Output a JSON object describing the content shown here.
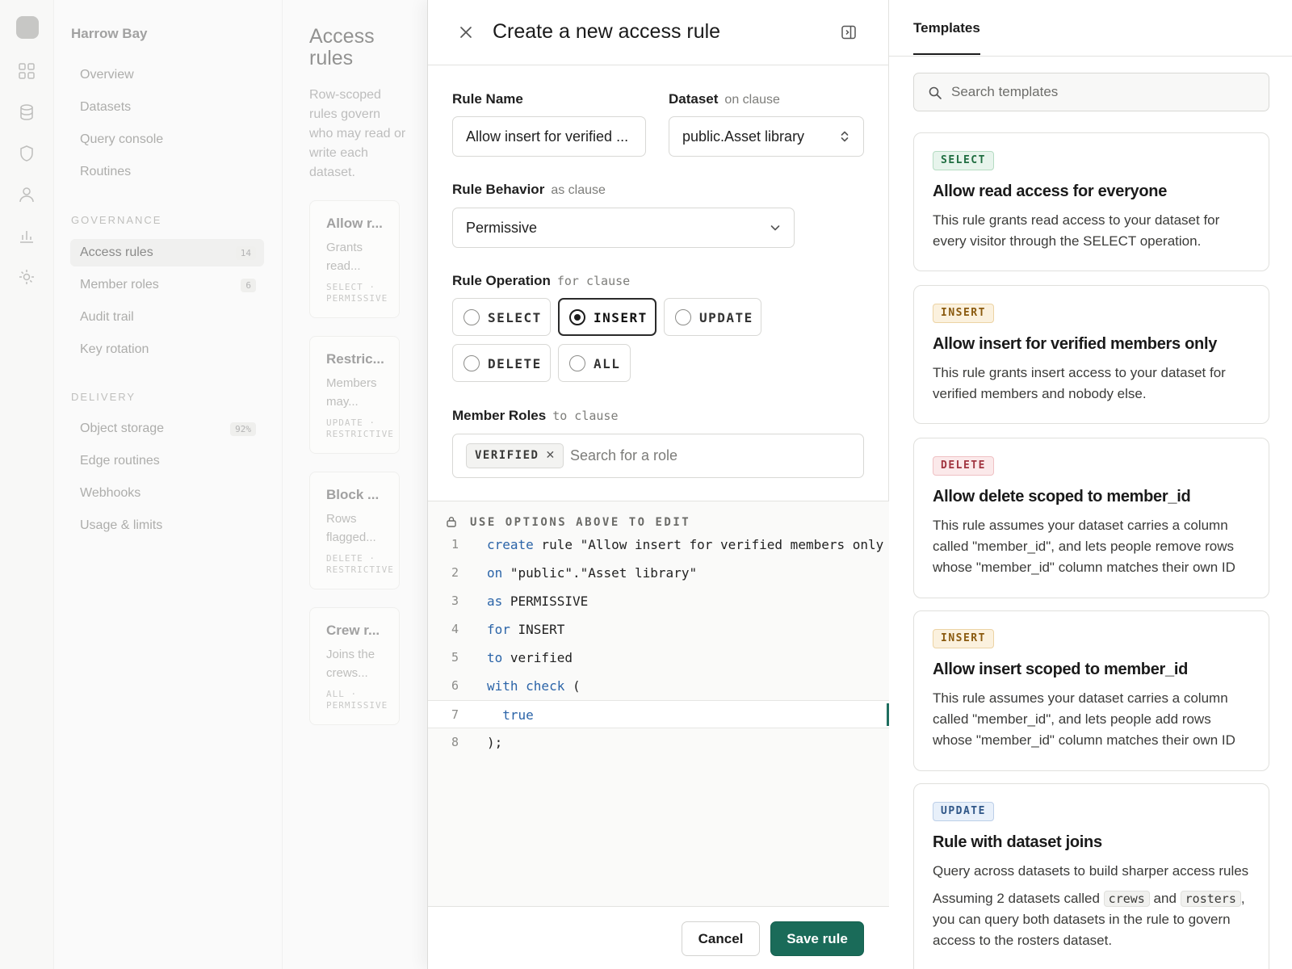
{
  "background": {
    "org_name": "Harrow Bay",
    "nav_items": [
      {
        "label": "Overview"
      },
      {
        "label": "Datasets"
      },
      {
        "label": "Query console"
      },
      {
        "label": "Routines"
      }
    ],
    "governance_section": "GOVERNANCE",
    "governance_items": [
      {
        "label": "Access rules",
        "count": "14"
      },
      {
        "label": "Member roles",
        "count": "6"
      },
      {
        "label": "Audit trail"
      },
      {
        "label": "Key rotation"
      }
    ],
    "delivery_section": "DELIVERY",
    "delivery_items": [
      {
        "label": "Object storage",
        "count": "92%"
      },
      {
        "label": "Edge routines"
      },
      {
        "label": "Webhooks"
      },
      {
        "label": "Usage & limits"
      }
    ],
    "list_title": "Access rules",
    "list_description": "Row-scoped rules govern who may read or write each dataset.",
    "list_cards": [
      {
        "title": "Allow r...",
        "desc": "Grants read...",
        "meta": "SELECT · PERMISSIVE"
      },
      {
        "title": "Restric...",
        "desc": "Members may...",
        "meta": "UPDATE · RESTRICTIVE"
      },
      {
        "title": "Block ...",
        "desc": "Rows flagged...",
        "meta": "DELETE · RESTRICTIVE"
      },
      {
        "title": "Crew r...",
        "desc": "Joins the crews...",
        "meta": "ALL · PERMISSIVE"
      }
    ]
  },
  "modal": {
    "title": "Create a new access rule",
    "rule_name": {
      "label": "Rule Name",
      "value": "Allow insert for verified ..."
    },
    "dataset": {
      "label": "Dataset",
      "hint": "on clause",
      "value": "public.Asset library"
    },
    "behavior": {
      "label": "Rule Behavior",
      "hint": "as clause",
      "value": "Permissive"
    },
    "operation": {
      "label": "Rule Operation",
      "hint": "for clause",
      "options": [
        "SELECT",
        "INSERT",
        "UPDATE",
        "DELETE",
        "ALL"
      ],
      "selected": "INSERT"
    },
    "roles": {
      "label": "Member Roles",
      "hint": "to clause",
      "chip": "VERIFIED",
      "placeholder": "Search for a role"
    },
    "editor": {
      "lock_message": "USE OPTIONS ABOVE TO EDIT",
      "lines": [
        {
          "n": "1",
          "kw": "create",
          "text": " rule \"Allow insert for verified members only"
        },
        {
          "n": "2",
          "kw": "on",
          "text": " \"public\".\"Asset library\""
        },
        {
          "n": "3",
          "kw": "as",
          "text": " PERMISSIVE"
        },
        {
          "n": "4",
          "kw": "for",
          "text": " INSERT"
        },
        {
          "n": "5",
          "kw": "to",
          "text": " verified"
        },
        {
          "n": "6",
          "kw": "with check",
          "text": " ("
        },
        {
          "n": "7",
          "kw": "  true",
          "text": ""
        },
        {
          "n": "8",
          "kw": "",
          "text": ");"
        }
      ]
    },
    "cancel_label": "Cancel",
    "save_label": "Save rule"
  },
  "templates": {
    "tab_label": "Templates",
    "search_placeholder": "Search templates",
    "cards": [
      {
        "badge": "SELECT",
        "title": "Allow read access for everyone",
        "desc": "This rule grants read access to your dataset for every visitor through the SELECT operation."
      },
      {
        "badge": "INSERT",
        "title": "Allow insert for verified members only",
        "desc": "This rule grants insert access to your dataset for verified members and nobody else."
      },
      {
        "badge": "DELETE",
        "title": "Allow delete scoped to member_id",
        "desc": "This rule assumes your dataset carries a column called \"member_id\", and lets people remove rows whose \"member_id\" column matches their own ID"
      },
      {
        "badge": "INSERT",
        "title": "Allow insert scoped to member_id",
        "desc": "This rule assumes your dataset carries a column called \"member_id\", and lets people add rows whose \"member_id\" column matches their own ID"
      },
      {
        "badge": "UPDATE",
        "title": "Rule with dataset joins",
        "desc": "Query across datasets to build sharper access rules",
        "desc2_pre": "Assuming 2 datasets called ",
        "desc2_code1": "crews",
        "desc2_mid": " and ",
        "desc2_code2": "rosters",
        "desc2_post": ", you can query both datasets in the rule to govern access to the rosters dataset."
      }
    ]
  }
}
